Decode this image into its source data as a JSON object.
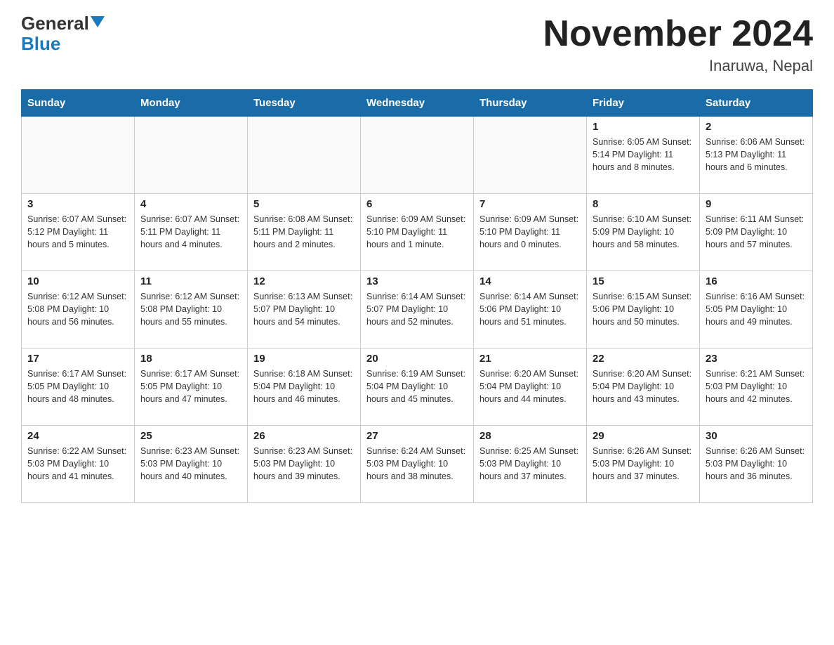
{
  "header": {
    "logo_general": "General",
    "logo_blue": "Blue",
    "month_title": "November 2024",
    "location": "Inaruwa, Nepal"
  },
  "days_of_week": [
    "Sunday",
    "Monday",
    "Tuesday",
    "Wednesday",
    "Thursday",
    "Friday",
    "Saturday"
  ],
  "weeks": [
    [
      {
        "day": "",
        "info": ""
      },
      {
        "day": "",
        "info": ""
      },
      {
        "day": "",
        "info": ""
      },
      {
        "day": "",
        "info": ""
      },
      {
        "day": "",
        "info": ""
      },
      {
        "day": "1",
        "info": "Sunrise: 6:05 AM\nSunset: 5:14 PM\nDaylight: 11 hours and 8 minutes."
      },
      {
        "day": "2",
        "info": "Sunrise: 6:06 AM\nSunset: 5:13 PM\nDaylight: 11 hours and 6 minutes."
      }
    ],
    [
      {
        "day": "3",
        "info": "Sunrise: 6:07 AM\nSunset: 5:12 PM\nDaylight: 11 hours and 5 minutes."
      },
      {
        "day": "4",
        "info": "Sunrise: 6:07 AM\nSunset: 5:11 PM\nDaylight: 11 hours and 4 minutes."
      },
      {
        "day": "5",
        "info": "Sunrise: 6:08 AM\nSunset: 5:11 PM\nDaylight: 11 hours and 2 minutes."
      },
      {
        "day": "6",
        "info": "Sunrise: 6:09 AM\nSunset: 5:10 PM\nDaylight: 11 hours and 1 minute."
      },
      {
        "day": "7",
        "info": "Sunrise: 6:09 AM\nSunset: 5:10 PM\nDaylight: 11 hours and 0 minutes."
      },
      {
        "day": "8",
        "info": "Sunrise: 6:10 AM\nSunset: 5:09 PM\nDaylight: 10 hours and 58 minutes."
      },
      {
        "day": "9",
        "info": "Sunrise: 6:11 AM\nSunset: 5:09 PM\nDaylight: 10 hours and 57 minutes."
      }
    ],
    [
      {
        "day": "10",
        "info": "Sunrise: 6:12 AM\nSunset: 5:08 PM\nDaylight: 10 hours and 56 minutes."
      },
      {
        "day": "11",
        "info": "Sunrise: 6:12 AM\nSunset: 5:08 PM\nDaylight: 10 hours and 55 minutes."
      },
      {
        "day": "12",
        "info": "Sunrise: 6:13 AM\nSunset: 5:07 PM\nDaylight: 10 hours and 54 minutes."
      },
      {
        "day": "13",
        "info": "Sunrise: 6:14 AM\nSunset: 5:07 PM\nDaylight: 10 hours and 52 minutes."
      },
      {
        "day": "14",
        "info": "Sunrise: 6:14 AM\nSunset: 5:06 PM\nDaylight: 10 hours and 51 minutes."
      },
      {
        "day": "15",
        "info": "Sunrise: 6:15 AM\nSunset: 5:06 PM\nDaylight: 10 hours and 50 minutes."
      },
      {
        "day": "16",
        "info": "Sunrise: 6:16 AM\nSunset: 5:05 PM\nDaylight: 10 hours and 49 minutes."
      }
    ],
    [
      {
        "day": "17",
        "info": "Sunrise: 6:17 AM\nSunset: 5:05 PM\nDaylight: 10 hours and 48 minutes."
      },
      {
        "day": "18",
        "info": "Sunrise: 6:17 AM\nSunset: 5:05 PM\nDaylight: 10 hours and 47 minutes."
      },
      {
        "day": "19",
        "info": "Sunrise: 6:18 AM\nSunset: 5:04 PM\nDaylight: 10 hours and 46 minutes."
      },
      {
        "day": "20",
        "info": "Sunrise: 6:19 AM\nSunset: 5:04 PM\nDaylight: 10 hours and 45 minutes."
      },
      {
        "day": "21",
        "info": "Sunrise: 6:20 AM\nSunset: 5:04 PM\nDaylight: 10 hours and 44 minutes."
      },
      {
        "day": "22",
        "info": "Sunrise: 6:20 AM\nSunset: 5:04 PM\nDaylight: 10 hours and 43 minutes."
      },
      {
        "day": "23",
        "info": "Sunrise: 6:21 AM\nSunset: 5:03 PM\nDaylight: 10 hours and 42 minutes."
      }
    ],
    [
      {
        "day": "24",
        "info": "Sunrise: 6:22 AM\nSunset: 5:03 PM\nDaylight: 10 hours and 41 minutes."
      },
      {
        "day": "25",
        "info": "Sunrise: 6:23 AM\nSunset: 5:03 PM\nDaylight: 10 hours and 40 minutes."
      },
      {
        "day": "26",
        "info": "Sunrise: 6:23 AM\nSunset: 5:03 PM\nDaylight: 10 hours and 39 minutes."
      },
      {
        "day": "27",
        "info": "Sunrise: 6:24 AM\nSunset: 5:03 PM\nDaylight: 10 hours and 38 minutes."
      },
      {
        "day": "28",
        "info": "Sunrise: 6:25 AM\nSunset: 5:03 PM\nDaylight: 10 hours and 37 minutes."
      },
      {
        "day": "29",
        "info": "Sunrise: 6:26 AM\nSunset: 5:03 PM\nDaylight: 10 hours and 37 minutes."
      },
      {
        "day": "30",
        "info": "Sunrise: 6:26 AM\nSunset: 5:03 PM\nDaylight: 10 hours and 36 minutes."
      }
    ]
  ]
}
